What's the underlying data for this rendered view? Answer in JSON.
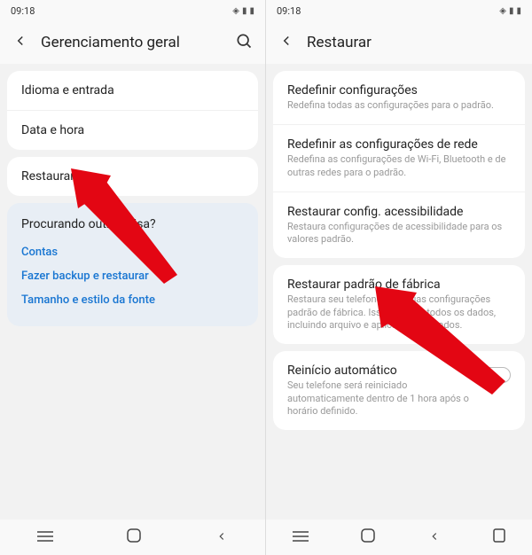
{
  "left": {
    "status_time": "09:18",
    "header_title": "Gerenciamento geral",
    "items": [
      {
        "title": "Idioma e entrada"
      },
      {
        "title": "Data e hora"
      }
    ],
    "restore_item": "Restaurar",
    "search_title": "Procurando outra coisa?",
    "links": [
      "Contas",
      "Fazer backup e restaurar",
      "Tamanho e estilo da fonte"
    ]
  },
  "right": {
    "status_time": "09:18",
    "header_title": "Restaurar",
    "group1": [
      {
        "title": "Redefinir configurações",
        "sub": "Redefina todas as configurações para o padrão."
      },
      {
        "title": "Redefinir as configurações de rede",
        "sub": "Redefina as configurações de Wi-Fi, Bluetooth e de outras redes para o padrão."
      },
      {
        "title": "Restaurar config. acessibilidade",
        "sub": "Restaura configurações de acessibilidade para os valores padrão."
      }
    ],
    "factory": {
      "title": "Restaurar padrão de fábrica",
      "sub": "Restaura seu telefone para suas configurações padrão de fábrica. Isso apagará todos os dados, incluindo arquivo e aplicativos baixados."
    },
    "auto_restart": {
      "title": "Reinício automático",
      "sub": "Seu telefone será reiniciado automaticamente dentro de 1 hora após o horário definido."
    }
  }
}
